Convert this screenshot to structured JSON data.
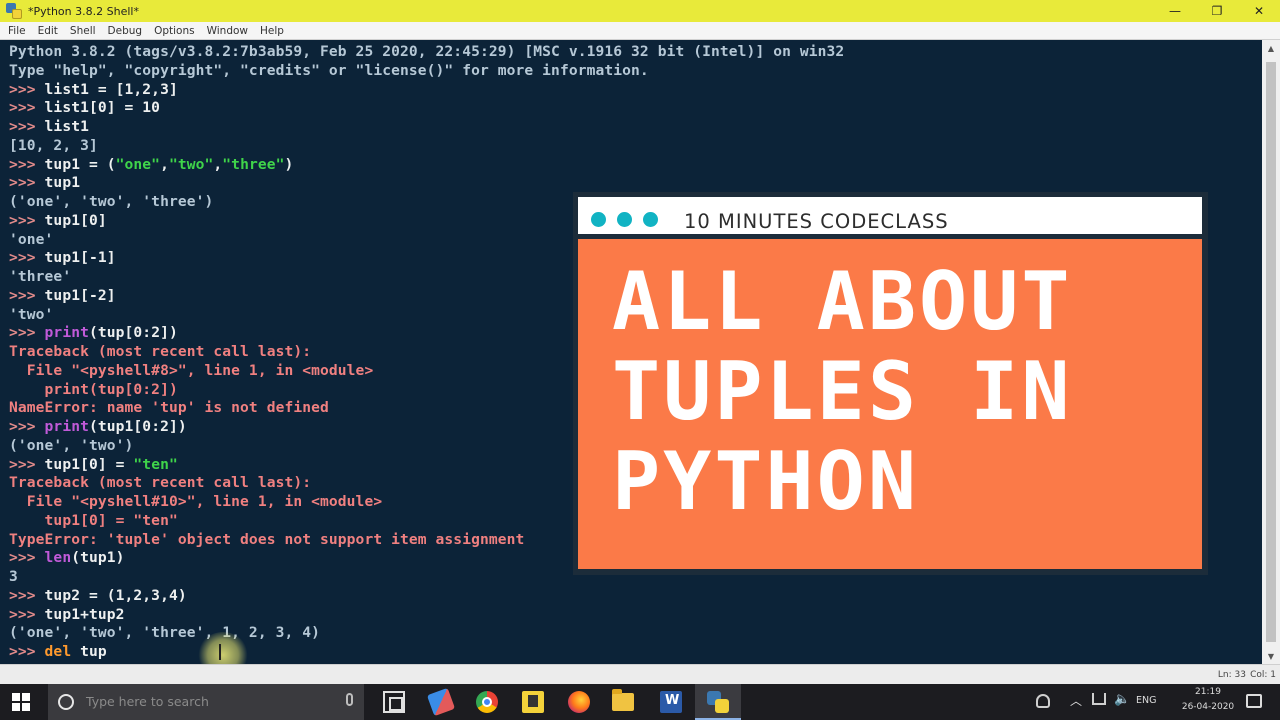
{
  "window": {
    "title": "*Python 3.8.2 Shell*",
    "controls": {
      "minimize": "—",
      "maximize": "❐",
      "close": "✕"
    }
  },
  "menu": [
    "File",
    "Edit",
    "Shell",
    "Debug",
    "Options",
    "Window",
    "Help"
  ],
  "shell": {
    "lines": [
      [
        {
          "t": "Python 3.8.2 (tags/v3.8.2:7b3ab59, Feb 25 2020, 22:45:29) [MSC v.1916 32 bit (Intel)] on win32",
          "c": "out"
        }
      ],
      [
        {
          "t": "Type \"help\", \"copyright\", \"credits\" or \"license()\" for more information.",
          "c": "out"
        }
      ],
      [
        {
          "t": ">>> ",
          "c": "prompt"
        },
        {
          "t": "list1 = [1,2,3]",
          "c": ""
        }
      ],
      [
        {
          "t": ">>> ",
          "c": "prompt"
        },
        {
          "t": "list1[0] = 10",
          "c": ""
        }
      ],
      [
        {
          "t": ">>> ",
          "c": "prompt"
        },
        {
          "t": "list1",
          "c": ""
        }
      ],
      [
        {
          "t": "[10, 2, 3]",
          "c": "out"
        }
      ],
      [
        {
          "t": ">>> ",
          "c": "prompt"
        },
        {
          "t": "tup1 = (",
          "c": ""
        },
        {
          "t": "\"one\"",
          "c": "str"
        },
        {
          "t": ",",
          "c": ""
        },
        {
          "t": "\"two\"",
          "c": "str"
        },
        {
          "t": ",",
          "c": ""
        },
        {
          "t": "\"three\"",
          "c": "str"
        },
        {
          "t": ")",
          "c": ""
        }
      ],
      [
        {
          "t": ">>> ",
          "c": "prompt"
        },
        {
          "t": "tup1",
          "c": ""
        }
      ],
      [
        {
          "t": "('one', 'two', 'three')",
          "c": "out"
        }
      ],
      [
        {
          "t": ">>> ",
          "c": "prompt"
        },
        {
          "t": "tup1[0]",
          "c": ""
        }
      ],
      [
        {
          "t": "'one'",
          "c": "out"
        }
      ],
      [
        {
          "t": ">>> ",
          "c": "prompt"
        },
        {
          "t": "tup1[-1]",
          "c": ""
        }
      ],
      [
        {
          "t": "'three'",
          "c": "out"
        }
      ],
      [
        {
          "t": ">>> ",
          "c": "prompt"
        },
        {
          "t": "tup1[-2]",
          "c": ""
        }
      ],
      [
        {
          "t": "'two'",
          "c": "out"
        }
      ],
      [
        {
          "t": ">>> ",
          "c": "prompt"
        },
        {
          "t": "print",
          "c": "builtin"
        },
        {
          "t": "(tup[0:2])",
          "c": ""
        }
      ],
      [
        {
          "t": "Traceback (most recent call last):",
          "c": "err"
        }
      ],
      [
        {
          "t": "  File \"<pyshell#8>\", line 1, in <module>",
          "c": "err"
        }
      ],
      [
        {
          "t": "    print(tup[0:2])",
          "c": "err"
        }
      ],
      [
        {
          "t": "NameError: name 'tup' is not defined",
          "c": "err"
        }
      ],
      [
        {
          "t": ">>> ",
          "c": "prompt"
        },
        {
          "t": "print",
          "c": "builtin"
        },
        {
          "t": "(tup1[0:2])",
          "c": ""
        }
      ],
      [
        {
          "t": "('one', 'two')",
          "c": "out"
        }
      ],
      [
        {
          "t": ">>> ",
          "c": "prompt"
        },
        {
          "t": "tup1[0] = ",
          "c": ""
        },
        {
          "t": "\"ten\"",
          "c": "str"
        }
      ],
      [
        {
          "t": "Traceback (most recent call last):",
          "c": "err"
        }
      ],
      [
        {
          "t": "  File \"<pyshell#10>\", line 1, in <module>",
          "c": "err"
        }
      ],
      [
        {
          "t": "    tup1[0] = \"ten\"",
          "c": "err"
        }
      ],
      [
        {
          "t": "TypeError: 'tuple' object does not support item assignment",
          "c": "err"
        }
      ],
      [
        {
          "t": ">>> ",
          "c": "prompt"
        },
        {
          "t": "len",
          "c": "builtin"
        },
        {
          "t": "(tup1)",
          "c": ""
        }
      ],
      [
        {
          "t": "3",
          "c": "out"
        }
      ],
      [
        {
          "t": ">>> ",
          "c": "prompt"
        },
        {
          "t": "tup2 = (1,2,3,4)",
          "c": ""
        }
      ],
      [
        {
          "t": ">>> ",
          "c": "prompt"
        },
        {
          "t": "tup1+tup2",
          "c": ""
        }
      ],
      [
        {
          "t": "('one', 'two', 'three', 1, 2, 3, 4)",
          "c": "out"
        }
      ],
      [
        {
          "t": ">>> ",
          "c": "prompt"
        },
        {
          "t": "del",
          "c": "kw"
        },
        {
          "t": " tup",
          "c": ""
        }
      ]
    ]
  },
  "status": {
    "line": "Ln: 33",
    "col": "Col: 1"
  },
  "taskbar": {
    "search_placeholder": "Type here to search",
    "lang": "ENG",
    "time": "21:19",
    "date": "26-04-2020"
  },
  "card": {
    "header": "10 MINUTES CODECLASS",
    "title_lines": [
      "ALL ABOUT",
      "TUPLES IN",
      "PYTHON"
    ],
    "colors": {
      "accent": "#fb7a48",
      "dots": "#11b3c3"
    }
  }
}
